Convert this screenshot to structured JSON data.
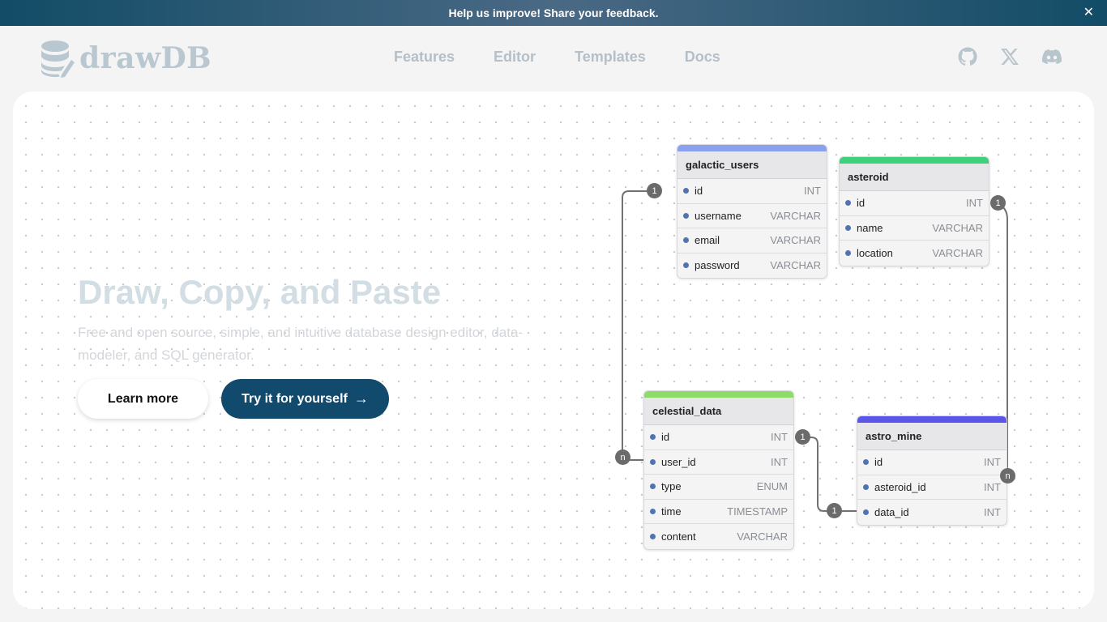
{
  "banner": {
    "text": "Help us improve! Share your feedback.",
    "close_label": "✕"
  },
  "nav": {
    "logo_text": "drawDB",
    "links": [
      "Features",
      "Editor",
      "Templates",
      "Docs"
    ]
  },
  "hero": {
    "title": "Draw, Copy, and Paste",
    "subtitle": "Free and open source, simple, and intuitive database design editor, data-modeler, and SQL generator.",
    "learn_more_label": "Learn more",
    "try_label": "Try it for yourself",
    "try_arrow": "→"
  },
  "tables": {
    "galactic_users": {
      "name": "galactic_users",
      "color": "#8aa1f0",
      "fields": [
        {
          "name": "id",
          "type": "INT"
        },
        {
          "name": "username",
          "type": "VARCHAR"
        },
        {
          "name": "email",
          "type": "VARCHAR"
        },
        {
          "name": "password",
          "type": "VARCHAR"
        }
      ]
    },
    "asteroid": {
      "name": "asteroid",
      "color": "#3ed07a",
      "fields": [
        {
          "name": "id",
          "type": "INT"
        },
        {
          "name": "name",
          "type": "VARCHAR"
        },
        {
          "name": "location",
          "type": "VARCHAR"
        }
      ]
    },
    "celestial_data": {
      "name": "celestial_data",
      "color": "#8ddc6a",
      "fields": [
        {
          "name": "id",
          "type": "INT"
        },
        {
          "name": "user_id",
          "type": "INT"
        },
        {
          "name": "type",
          "type": "ENUM"
        },
        {
          "name": "time",
          "type": "TIMESTAMP"
        },
        {
          "name": "content",
          "type": "VARCHAR"
        }
      ]
    },
    "astro_mine": {
      "name": "astro_mine",
      "color": "#5b55ea",
      "fields": [
        {
          "name": "id",
          "type": "INT"
        },
        {
          "name": "asteroid_id",
          "type": "INT"
        },
        {
          "name": "data_id",
          "type": "INT"
        }
      ]
    }
  },
  "relations": {
    "users_id": "1",
    "celestial_user_id": "n",
    "asteroid_id": "1",
    "celestial_id": "1",
    "mine_data_id": "1",
    "mine_asteroid_id": "n"
  }
}
